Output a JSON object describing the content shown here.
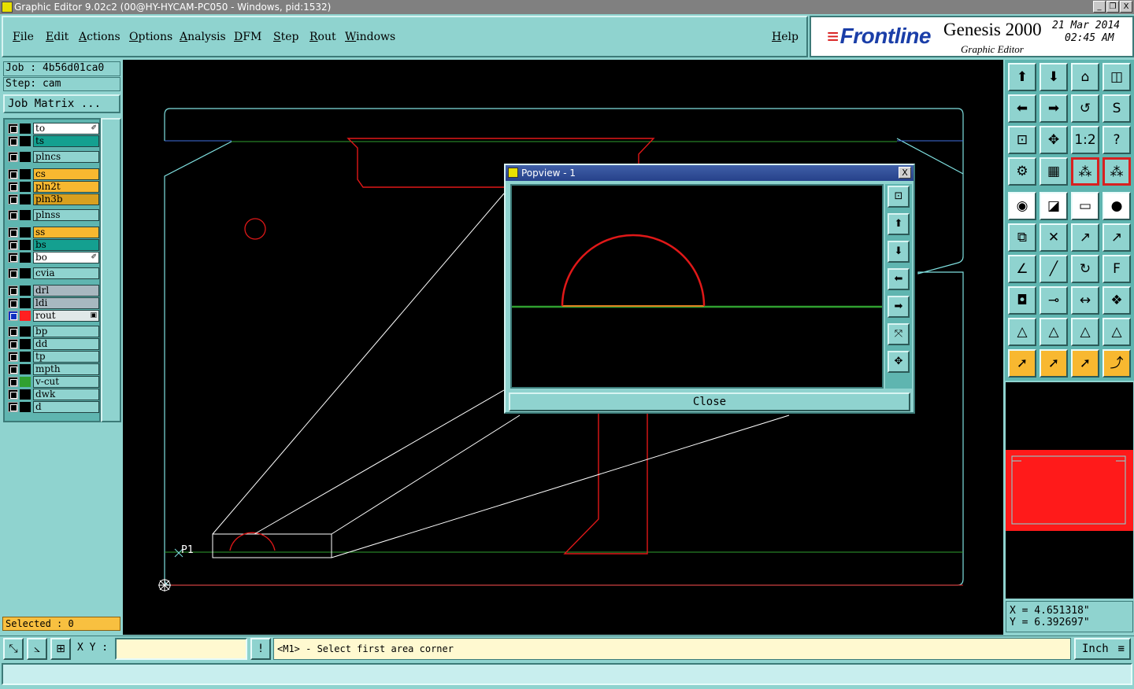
{
  "window": {
    "title": "Graphic Editor 9.02c2 (00@HY-HYCAM-PC050 - Windows, pid:1532)",
    "minimize": "_",
    "maximize": "❐",
    "close": "X"
  },
  "menu": {
    "items": [
      "File",
      "Edit",
      "Actions",
      "Options",
      "Analysis",
      "DFM",
      "Step",
      "Rout",
      "Windows"
    ],
    "help": "Help"
  },
  "brand": {
    "logo": "Frontline",
    "product": "Genesis 2000",
    "subtitle": "Graphic Editor",
    "date": "21 Mar 2014",
    "time": "02:45 AM"
  },
  "job": {
    "job_label": "Job : 4b56d01ca0",
    "step_label": "Step: cam",
    "matrix_button": "Job Matrix ..."
  },
  "layers": [
    {
      "name": "to",
      "color": "#ffffff",
      "swatch": "#000000",
      "marker": "✐",
      "selected": false
    },
    {
      "name": "ts",
      "color": "#14a090",
      "swatch": "#000000",
      "marker": "",
      "selected": false
    },
    {
      "name": "plncs",
      "color": "#8fd3cf",
      "swatch": "#000000",
      "marker": "",
      "selected": false
    },
    {
      "name": "cs",
      "color": "#f8b830",
      "swatch": "#000000",
      "marker": "",
      "selected": false
    },
    {
      "name": "pln2t",
      "color": "#f8b830",
      "swatch": "#000000",
      "marker": "",
      "selected": false
    },
    {
      "name": "pln3b",
      "color": "#d8a020",
      "swatch": "#000000",
      "marker": "",
      "selected": false
    },
    {
      "name": "plnss",
      "color": "#8fd3cf",
      "swatch": "#000000",
      "marker": "",
      "selected": false
    },
    {
      "name": "ss",
      "color": "#f8b830",
      "swatch": "#000000",
      "marker": "",
      "selected": false
    },
    {
      "name": "bs",
      "color": "#14a090",
      "swatch": "#000000",
      "marker": "",
      "selected": false
    },
    {
      "name": "bo",
      "color": "#ffffff",
      "swatch": "#000000",
      "marker": "✐",
      "selected": false
    },
    {
      "name": "cvia",
      "color": "#8fd3cf",
      "swatch": "#000000",
      "marker": "",
      "selected": false
    },
    {
      "name": "drl",
      "color": "#a8b8c0",
      "swatch": "#000000",
      "marker": "",
      "selected": false
    },
    {
      "name": "ldi",
      "color": "#a8b8c0",
      "swatch": "#000000",
      "marker": "",
      "selected": false
    },
    {
      "name": "rout",
      "color": "#e0e8e8",
      "swatch": "#ff2020",
      "marker": "▣",
      "selected": true
    },
    {
      "name": "bp",
      "color": "#8fd3cf",
      "swatch": "#000000",
      "marker": "",
      "selected": false
    },
    {
      "name": "dd",
      "color": "#8fd3cf",
      "swatch": "#000000",
      "marker": "",
      "selected": false
    },
    {
      "name": "tp",
      "color": "#8fd3cf",
      "swatch": "#000000",
      "marker": "",
      "selected": false
    },
    {
      "name": "mpth",
      "color": "#8fd3cf",
      "swatch": "#000000",
      "marker": "",
      "selected": false
    },
    {
      "name": "v-cut",
      "color": "#8fd3cf",
      "swatch": "#30a030",
      "marker": "",
      "selected": false
    },
    {
      "name": "dwk",
      "color": "#8fd3cf",
      "swatch": "#000000",
      "marker": "",
      "selected": false
    },
    {
      "name": "d",
      "color": "#8fd3cf",
      "swatch": "#000000",
      "marker": "",
      "selected": false
    }
  ],
  "selected_label": "Selected : 0",
  "canvas": {
    "point_label": "P1"
  },
  "popview": {
    "title": "Popview - 1",
    "close_x": "X",
    "close_button": "Close",
    "tools": [
      "zoom-fit-icon",
      "pan-up-icon",
      "pan-down-icon",
      "pan-left-icon",
      "pan-right-icon",
      "zoom-in-icon",
      "zoom-out-icon"
    ]
  },
  "toolbar": {
    "buttons": [
      {
        "icon": "pan-up-icon",
        "glyph": "⬆",
        "style": ""
      },
      {
        "icon": "pan-down-icon",
        "glyph": "⬇",
        "style": ""
      },
      {
        "icon": "home-icon",
        "glyph": "⌂",
        "style": ""
      },
      {
        "icon": "split-view-icon",
        "glyph": "◫",
        "style": ""
      },
      {
        "icon": "pan-left-icon",
        "glyph": "⬅",
        "style": ""
      },
      {
        "icon": "pan-right-icon",
        "glyph": "➡",
        "style": ""
      },
      {
        "icon": "undo-view-icon",
        "glyph": "↺",
        "style": ""
      },
      {
        "icon": "redraw-icon",
        "glyph": "S",
        "style": ""
      },
      {
        "icon": "zoom-fit-icon",
        "glyph": "⊡",
        "style": ""
      },
      {
        "icon": "zoom-center-icon",
        "glyph": "✥",
        "style": ""
      },
      {
        "icon": "scale-icon",
        "glyph": "1:2",
        "style": ""
      },
      {
        "icon": "help-icon",
        "glyph": "?",
        "style": ""
      },
      {
        "icon": "tools-icon",
        "glyph": "⚙",
        "style": ""
      },
      {
        "icon": "grid-icon",
        "glyph": "▦",
        "style": ""
      },
      {
        "icon": "snap-red-icon",
        "glyph": "⁂",
        "style": "r"
      },
      {
        "icon": "snap-red-2-icon",
        "glyph": "⁂",
        "style": "r"
      },
      {
        "icon": "select-feature-icon",
        "glyph": "◉",
        "style": "w"
      },
      {
        "icon": "measure-icon",
        "glyph": "◪",
        "style": "w"
      },
      {
        "icon": "ruler-icon",
        "glyph": "▭",
        "style": "w"
      },
      {
        "icon": "pad-icon",
        "glyph": "●",
        "style": "w"
      },
      {
        "icon": "connect-icon",
        "glyph": "⧉",
        "style": ""
      },
      {
        "icon": "delete-icon",
        "glyph": "✕",
        "style": ""
      },
      {
        "icon": "move-icon",
        "glyph": "↗",
        "style": ""
      },
      {
        "icon": "copy-icon",
        "glyph": "↗",
        "style": ""
      },
      {
        "icon": "angle-icon",
        "glyph": "∠",
        "style": ""
      },
      {
        "icon": "line-icon",
        "glyph": "╱",
        "style": ""
      },
      {
        "icon": "arc-icon",
        "glyph": "↻",
        "style": ""
      },
      {
        "icon": "fill-icon",
        "glyph": "F",
        "style": ""
      },
      {
        "icon": "pad-add-icon",
        "glyph": "◘",
        "style": ""
      },
      {
        "icon": "cut-icon",
        "glyph": "⊸",
        "style": ""
      },
      {
        "icon": "dimension-icon",
        "glyph": "↔",
        "style": ""
      },
      {
        "icon": "shapes-icon",
        "glyph": "❖",
        "style": ""
      },
      {
        "icon": "triangle-icon",
        "glyph": "△",
        "style": ""
      },
      {
        "icon": "triangle-2-icon",
        "glyph": "△",
        "style": ""
      },
      {
        "icon": "triangle-3-icon",
        "glyph": "△",
        "style": ""
      },
      {
        "icon": "triangle-4-icon",
        "glyph": "△",
        "style": ""
      },
      {
        "icon": "pointer-icon",
        "glyph": "➚",
        "style": "y"
      },
      {
        "icon": "pointer-box-icon",
        "glyph": "➚",
        "style": "y"
      },
      {
        "icon": "pointer-select-icon",
        "glyph": "➚",
        "style": "y"
      },
      {
        "icon": "route-icon",
        "glyph": "⤴",
        "style": "y"
      }
    ]
  },
  "coords": {
    "x": "X = 4.651318\"",
    "y": "Y = 6.392697\""
  },
  "bottom": {
    "xy_label": "X Y :",
    "xy_value": "",
    "prompt": "<M1> - Select first area corner",
    "units": "Inch"
  },
  "colors": {
    "profile": "#7fe0e0",
    "rout": "#e01818",
    "vcut": "#30a030",
    "background": "#000000"
  }
}
